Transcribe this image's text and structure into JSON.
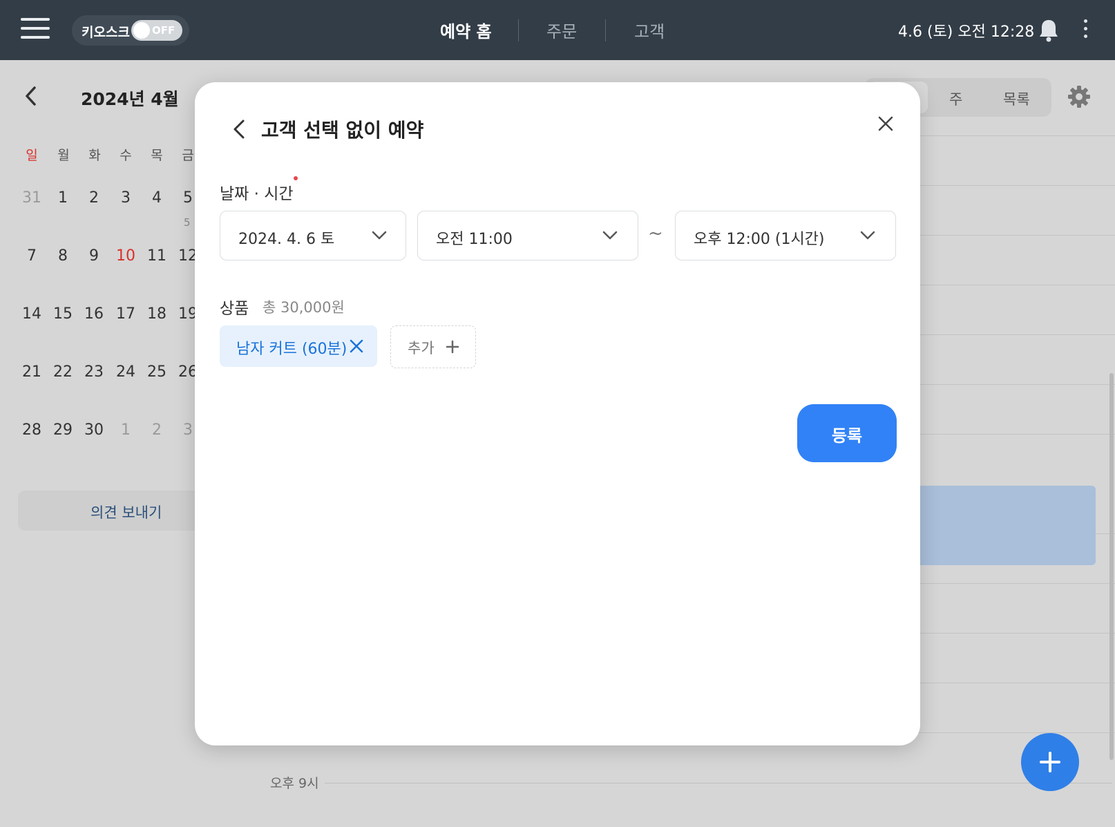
{
  "topbar": {
    "kiosk_label": "키오스크",
    "kiosk_state": "OFF",
    "nav": [
      "예약 홈",
      "주문",
      "고객"
    ],
    "active_nav": "예약 홈",
    "datetime": "4.6 (토) 오전 12:28"
  },
  "calendar": {
    "title": "2024년 4월",
    "weekdays": [
      "일",
      "월",
      "화",
      "수",
      "목",
      "금"
    ],
    "weeks": [
      [
        "31",
        "1",
        "2",
        "3",
        "4",
        "5"
      ],
      [
        "7",
        "8",
        "9",
        "10",
        "11",
        "12"
      ],
      [
        "14",
        "15",
        "16",
        "17",
        "18",
        "19"
      ],
      [
        "21",
        "22",
        "23",
        "24",
        "25",
        "26"
      ],
      [
        "28",
        "29",
        "30",
        "1",
        "2",
        "3"
      ]
    ],
    "friday_count": "5",
    "feedback_label": "의견 보내기"
  },
  "view_tabs": [
    "주",
    "목록"
  ],
  "schedule": {
    "time_label": "오후 9시"
  },
  "modal": {
    "title": "고객 선택 없이 예약",
    "datetime_label": "날짜 · 시간",
    "date_value": "2024. 4. 6 토",
    "start_time": "오전 11:00",
    "tilde": "~",
    "end_time": "오후 12:00 (1시간)",
    "product_label": "상품",
    "product_total": "총 30,000원",
    "product_chip": "남자 커트 (60분)",
    "add_label": "추가",
    "submit_label": "등록"
  },
  "colors": {
    "topbar": "#333d47",
    "accent": "#3182f6",
    "sunday": "#d9302c",
    "chip_bg": "#e7f1fd"
  }
}
